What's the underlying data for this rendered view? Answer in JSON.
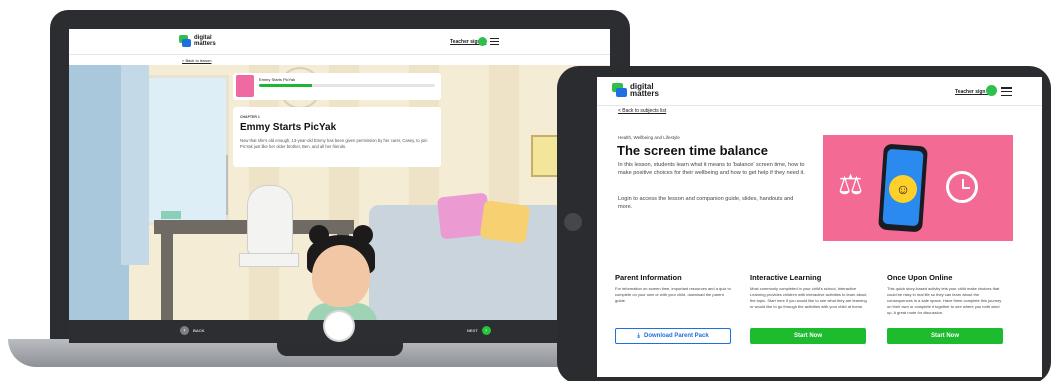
{
  "laptop": {
    "header": {
      "logo_line1": "digital",
      "logo_line2": "matters",
      "teacher_link": "Teacher sign in"
    },
    "back_link": "< Back to lesson",
    "progress_title": "Emmy Starts PicYak",
    "progress_value": 0.3,
    "chapter": {
      "kicker": "CHAPTER 1",
      "title": "Emmy Starts PicYak",
      "body": "Now that she's old enough, 13-year-old Emmy has been given permission by her carer, Casey, to join PicYak just like her older brother, Ben, and all her friends."
    },
    "footer": {
      "back_label": "BACK",
      "next_label": "NEXT"
    }
  },
  "tablet": {
    "header": {
      "logo_line1": "digital",
      "logo_line2": "matters",
      "teacher_link": "Teacher sign in"
    },
    "back_link": "< Back to subjects list",
    "subject": "Health, Wellbeing and Lifestyle",
    "title": "The screen time balance",
    "description": "In this lesson, students learn what it means to 'balance' screen time, how to make positive choices for their wellbeing and how to get help if they need it.",
    "login_text": "Login to access the lesson and companion guide, slides, handouts and more.",
    "columns": [
      {
        "title": "Parent Information",
        "body": "For information on screen time, important resources and a quiz to complete on your own or with your child, download the parent guide.",
        "button": "Download Parent Pack"
      },
      {
        "title": "Interactive Learning",
        "body": "Most commonly completed in your child's school, Interactive Learning provides children with interactive activities to learn about the topic. Start here if you would like to see what they are learning or would like to go through the activities with your child at home.",
        "button": "Start Now"
      },
      {
        "title": "Once Upon Online",
        "body": "This quick story-based activity lets your child make choices that could be risky in real life so they can learn about the consequences in a safe space. Have them complete this journey on their own or complete it together to see where you both wind up. A great route for discussion.",
        "button": "Start Now"
      }
    ]
  },
  "colors": {
    "brand_green": "#1dbb2e",
    "brand_blue": "#1e6fe0",
    "hero_pink": "#f36a94",
    "device_dark": "#2a2c30"
  },
  "icons": [
    "user-icon",
    "menu-icon",
    "download-icon",
    "chevron-left-icon",
    "chevron-right-icon",
    "scale-icon",
    "clock-icon",
    "emoji-icon"
  ]
}
